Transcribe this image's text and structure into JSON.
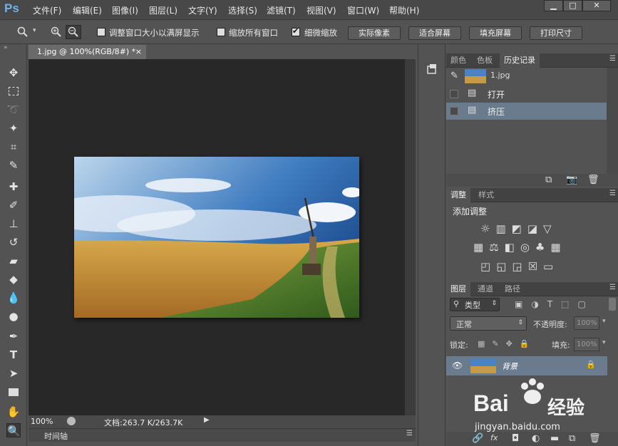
{
  "app": {
    "logo": "Ps"
  },
  "menu": [
    "文件(F)",
    "编辑(E)",
    "图像(I)",
    "图层(L)",
    "文字(Y)",
    "选择(S)",
    "滤镜(T)",
    "视图(V)",
    "窗口(W)",
    "帮助(H)"
  ],
  "window_controls": {
    "minimize": "▁",
    "restore": "□",
    "close": "✕"
  },
  "options_bar": {
    "zoom_icon": "zoom-icon",
    "resize_windows_label": "调整窗口大小以满屏显示",
    "zoom_all_label": "缩放所有窗口",
    "scrubby_zoom_label": "细微缩放",
    "actual_pixels": "实际像素",
    "fit_screen": "适合屏幕",
    "fill_screen": "填充屏幕",
    "print_size": "打印尺寸"
  },
  "document": {
    "tab_title": "1.jpg @ 100%(RGB/8#) *",
    "close": "×"
  },
  "status": {
    "zoom": "100%",
    "doc_size": "文档:263.7 K/263.7K"
  },
  "timeline": {
    "label": "时间轴"
  },
  "panels": {
    "top_tabs": [
      "颜色",
      "色板",
      "历史记录"
    ],
    "history": {
      "snapshot_name": "1.jpg",
      "items": [
        "打开",
        "挤压"
      ]
    },
    "adjust_tabs": [
      "调整",
      "样式"
    ],
    "adjust_title": "添加调整",
    "layers_tabs": [
      "图层",
      "通道",
      "路径"
    ],
    "layers": {
      "kind": "类型",
      "blend_mode": "正常",
      "opacity_label": "不透明度:",
      "opacity": "100%",
      "lock_label": "锁定:",
      "fill_label": "填充:",
      "fill": "100%",
      "layer_name": "背景"
    }
  },
  "watermark": {
    "brand": "Bai",
    "brand2": "经验",
    "url": "jingyan.baidu.com"
  },
  "colors": {
    "accent": "#6fb3ea",
    "selection": "#6b7b8e",
    "canvas_bg": "#282828"
  }
}
